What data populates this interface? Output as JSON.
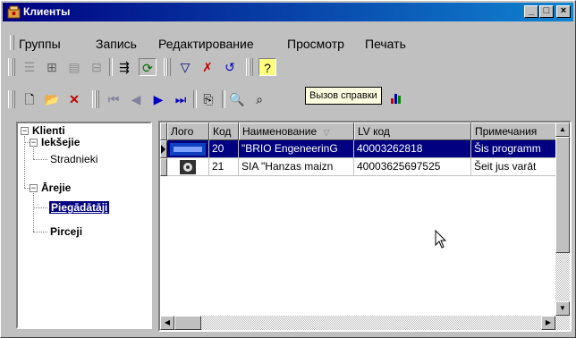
{
  "window": {
    "title": "Клиенты"
  },
  "menu": [
    "Группы",
    "Запись",
    "Редактирование",
    "Просмотр",
    "Печать"
  ],
  "tooltip": "Вызов справки",
  "tree": {
    "root": "Klienti",
    "children": [
      {
        "label": "Iekšejie",
        "children": [
          "Stradnieki"
        ]
      },
      {
        "label": "Ārejie",
        "children": [
          "Piegādātāji",
          "Pirceji"
        ]
      }
    ]
  },
  "grid": {
    "columns": [
      "Лого",
      "Код",
      "Наименование",
      "LV код",
      "Примечания"
    ],
    "rows": [
      {
        "code": "20",
        "name": "\"BRIO EngeneerinG",
        "lv": "40003262818",
        "note": "Šis programm"
      },
      {
        "code": "21",
        "name": "SIA \"Hanzas maizn",
        "lv": "40003625697525",
        "note": "Šeit jus varāt"
      }
    ]
  },
  "colors": {
    "title_start": "#000080",
    "title_end": "#1084d0",
    "selection": "#000080",
    "face": "#c0c0c0"
  }
}
